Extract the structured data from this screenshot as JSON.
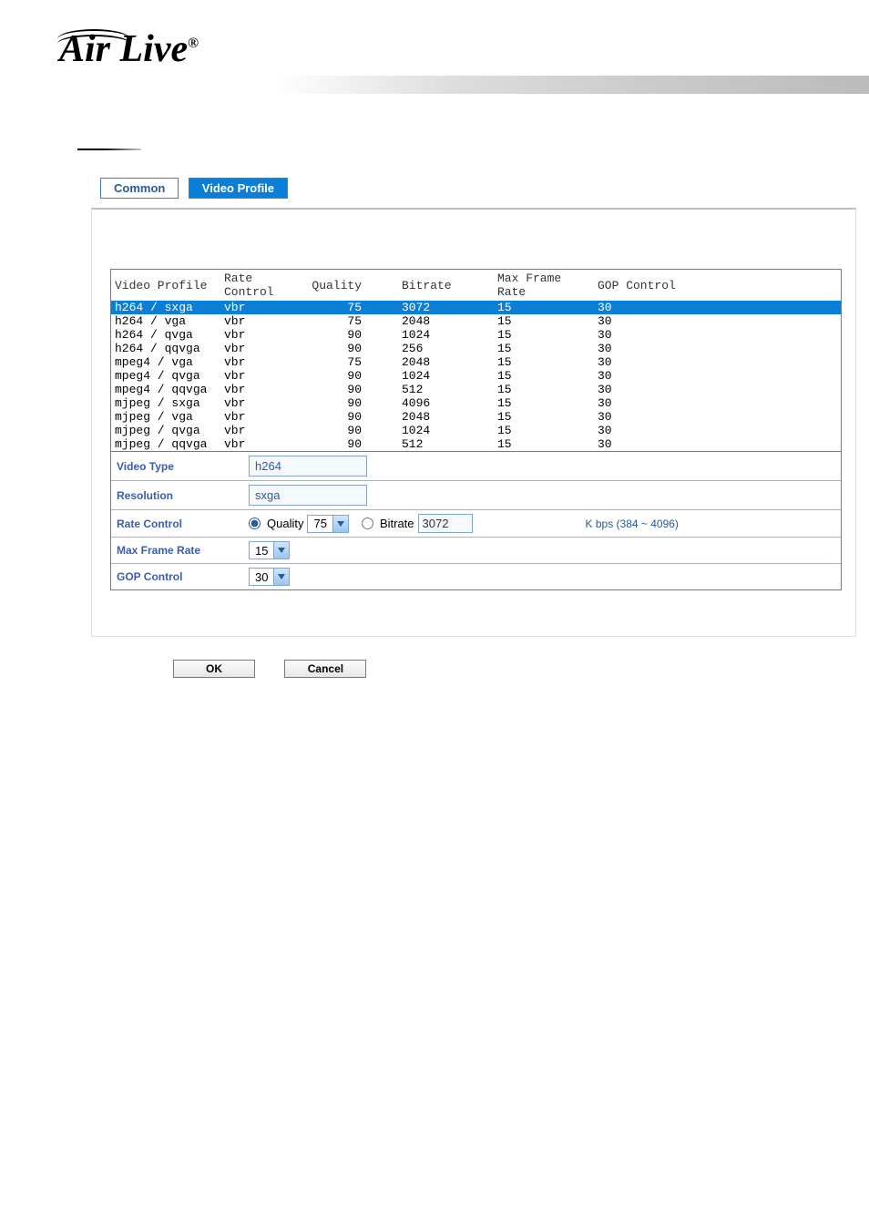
{
  "logo": "Air Live",
  "tabs": {
    "common": "Common",
    "video_profile": "Video Profile"
  },
  "table": {
    "headers": [
      "Video Profile",
      "Rate Control",
      "Quality",
      "Bitrate",
      "Max Frame Rate",
      "GOP Control"
    ],
    "rows": [
      {
        "p": "h264 / sxga",
        "rc": "vbr",
        "q": "75",
        "b": "3072",
        "f": "15",
        "g": "30",
        "sel": true
      },
      {
        "p": "h264 / vga",
        "rc": "vbr",
        "q": "75",
        "b": "2048",
        "f": "15",
        "g": "30"
      },
      {
        "p": "h264 / qvga",
        "rc": "vbr",
        "q": "90",
        "b": "1024",
        "f": "15",
        "g": "30"
      },
      {
        "p": "h264 / qqvga",
        "rc": "vbr",
        "q": "90",
        "b": "256",
        "f": "15",
        "g": "30"
      },
      {
        "p": "mpeg4 / vga",
        "rc": "vbr",
        "q": "75",
        "b": "2048",
        "f": "15",
        "g": "30"
      },
      {
        "p": "mpeg4 / qvga",
        "rc": "vbr",
        "q": "90",
        "b": "1024",
        "f": "15",
        "g": "30"
      },
      {
        "p": "mpeg4 / qqvga",
        "rc": "vbr",
        "q": "90",
        "b": "512",
        "f": "15",
        "g": "30"
      },
      {
        "p": "mjpeg / sxga",
        "rc": "vbr",
        "q": "90",
        "b": "4096",
        "f": "15",
        "g": "30"
      },
      {
        "p": "mjpeg / vga",
        "rc": "vbr",
        "q": "90",
        "b": "2048",
        "f": "15",
        "g": "30"
      },
      {
        "p": "mjpeg / qvga",
        "rc": "vbr",
        "q": "90",
        "b": "1024",
        "f": "15",
        "g": "30"
      },
      {
        "p": "mjpeg / qqvga",
        "rc": "vbr",
        "q": "90",
        "b": "512",
        "f": "15",
        "g": "30"
      }
    ]
  },
  "form": {
    "video_type": {
      "label": "Video Type",
      "value": "h264"
    },
    "resolution": {
      "label": "Resolution",
      "value": "sxga"
    },
    "rate_control": {
      "label": "Rate Control",
      "quality_label": "Quality",
      "quality_value": "75",
      "bitrate_label": "Bitrate",
      "bitrate_value": "3072",
      "hint": "K bps (384 ~ 4096)"
    },
    "max_frame_rate": {
      "label": "Max Frame Rate",
      "value": "15"
    },
    "gop_control": {
      "label": "GOP Control",
      "value": "30"
    }
  },
  "buttons": {
    "ok": "OK",
    "cancel": "Cancel"
  }
}
